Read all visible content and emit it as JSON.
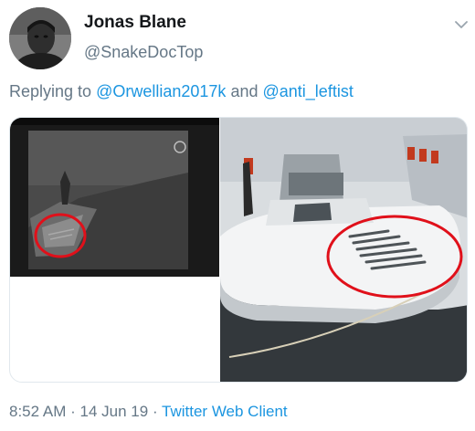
{
  "tweet": {
    "author_name": "Jonas Blane",
    "author_handle": "@SnakeDocTop",
    "replying_prefix": "Replying to",
    "mentions": [
      "@Orwellian2017k",
      "@anti_leftist"
    ],
    "replying_conjunction": "and",
    "time": "8:52 AM",
    "separator": "·",
    "date": "14 Jun 19",
    "source": "Twitter Web Client"
  },
  "icons": {
    "avatar": "avatar-photo",
    "menu": "chevron-down-icon"
  },
  "colors": {
    "link": "#1b95e0",
    "secondary_text": "#657786",
    "annotation_circle": "#e0101a"
  }
}
